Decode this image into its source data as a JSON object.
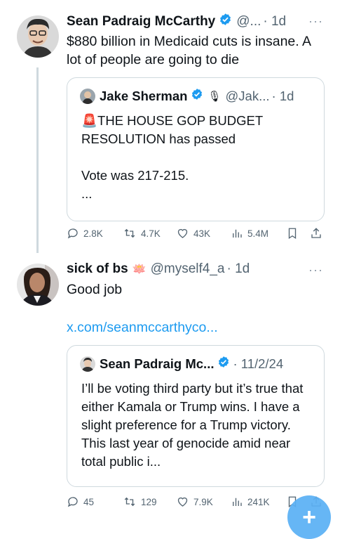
{
  "tweet1": {
    "name": "Sean Padraig McCarthy",
    "handle": "@...",
    "time": "· 1d",
    "text": "$880 billion in Medicaid cuts is insane. A lot of people are going to die",
    "quote": {
      "name": "Jake Sherman",
      "handle": "@Jak...",
      "time": "· 1d",
      "text": "🚨THE HOUSE GOP BUDGET RESOLUTION has passed\n\nVote was 217-215.\n...",
      "emoji": "🎙"
    },
    "actions": {
      "replies": "2.8K",
      "reposts": "4.7K",
      "likes": "43K",
      "views": "5.4M"
    }
  },
  "tweet2": {
    "name": "sick of bs",
    "emoji": "🪷",
    "handle": "@myself4_a",
    "time": "· 1d",
    "text": "Good job",
    "link": "x.com/seanmccarthyco...",
    "quote": {
      "name": "Sean Padraig Mc...",
      "time": "· 11/2/24",
      "text": "I’ll be voting third party but it’s true that either Kamala or Trump wins. I have a slight preference for a Trump victory. This last year of genocide amid near total public i..."
    },
    "actions": {
      "replies": "45",
      "reposts": "129",
      "likes": "7.9K",
      "views": "241K"
    }
  },
  "fab_label": "+",
  "more_label": "···",
  "colors": {
    "accent": "#1d9bf0",
    "muted": "#536471",
    "border": "#cfd9de"
  }
}
